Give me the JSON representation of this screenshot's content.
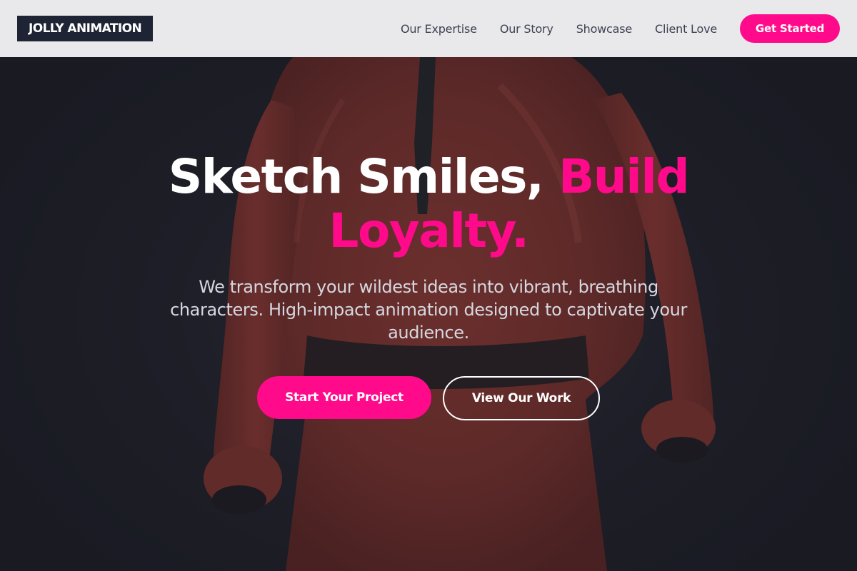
{
  "brand": {
    "logo_text": "JOLLY ANIMATION"
  },
  "nav": {
    "links": [
      {
        "label": "Our Expertise"
      },
      {
        "label": "Our Story"
      },
      {
        "label": "Showcase"
      },
      {
        "label": "Client Love"
      }
    ],
    "cta_label": "Get Started"
  },
  "hero": {
    "headline_part1": "Sketch Smiles, ",
    "headline_accent": "Build Loyalty.",
    "subtext": "We transform your wildest ideas into vibrant, breathing characters. High-impact animation designed to captivate your audience.",
    "primary_button": "Start Your Project",
    "secondary_button": "View Our Work",
    "background_image": "red-suited-character-back-view"
  },
  "colors": {
    "accent": "#ff0a8a",
    "navbar_bg": "#e9e9ec",
    "logo_bg": "#1e2433",
    "hero_bg": "#20212b",
    "nav_text": "#3d4252"
  }
}
